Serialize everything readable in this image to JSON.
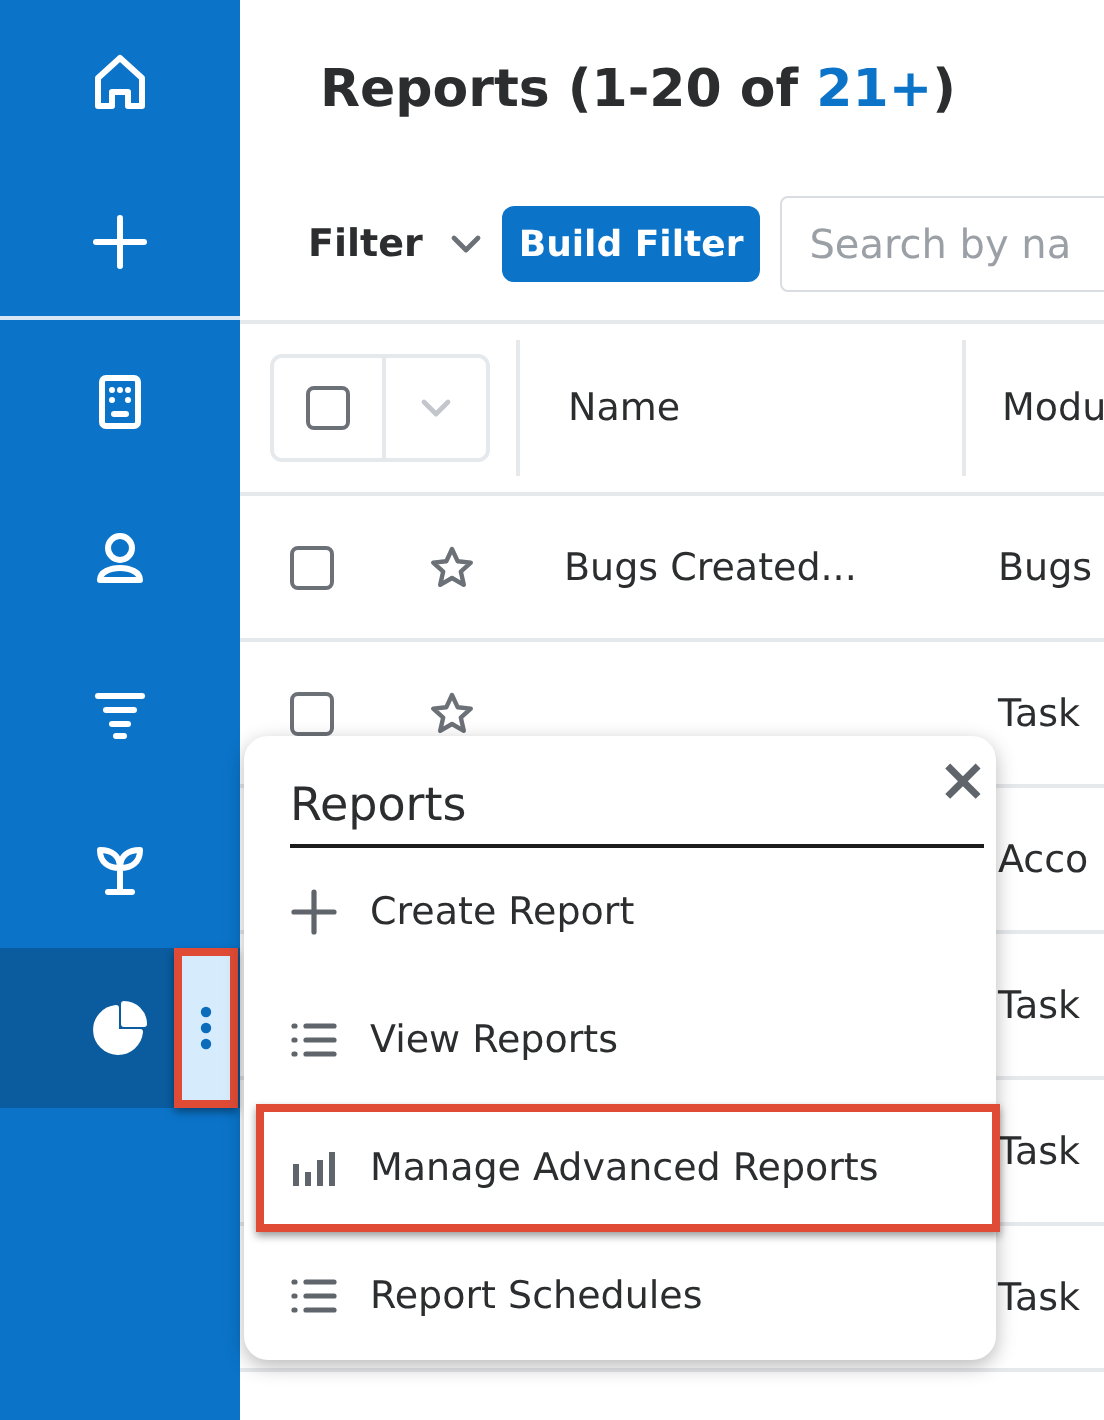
{
  "sidebar": {
    "items": [
      {
        "selected": false
      },
      {
        "selected": false
      },
      {
        "selected": false
      },
      {
        "selected": false
      },
      {
        "selected": false
      },
      {
        "selected": false
      },
      {
        "selected": true,
        "menu_button": {
          "highlighted": true
        }
      }
    ]
  },
  "header": {
    "title": "Reports (1-20 of ",
    "count": "21+",
    "title_end": ")"
  },
  "filter_bar": {
    "filter_label": "Filter",
    "build_filter": "Build Filter",
    "search": {
      "placeholder": "Search by na"
    }
  },
  "table": {
    "columns": [
      "Name",
      "Modu"
    ],
    "select_all": {
      "checked": false
    },
    "rows": [
      {
        "checked": false,
        "favorite": false,
        "name": "Bugs Created...",
        "module": "Bugs"
      },
      {
        "checked": false,
        "favorite": false,
        "module": "Task"
      },
      {
        "module": "Acco"
      },
      {
        "module": "Task"
      },
      {
        "module": "Task"
      },
      {
        "module": "Task"
      }
    ]
  },
  "popup_menu": {
    "title": "Reports",
    "close": "×",
    "items": [
      {
        "kind": "plus",
        "label": "Create Report",
        "highlighted": false
      },
      {
        "kind": "list",
        "label": "View Reports",
        "highlighted": false
      },
      {
        "kind": "bars",
        "label": "Manage Advanced Reports",
        "highlighted": true
      },
      {
        "kind": "list",
        "label": "Report Schedules",
        "highlighted": false
      }
    ]
  }
}
